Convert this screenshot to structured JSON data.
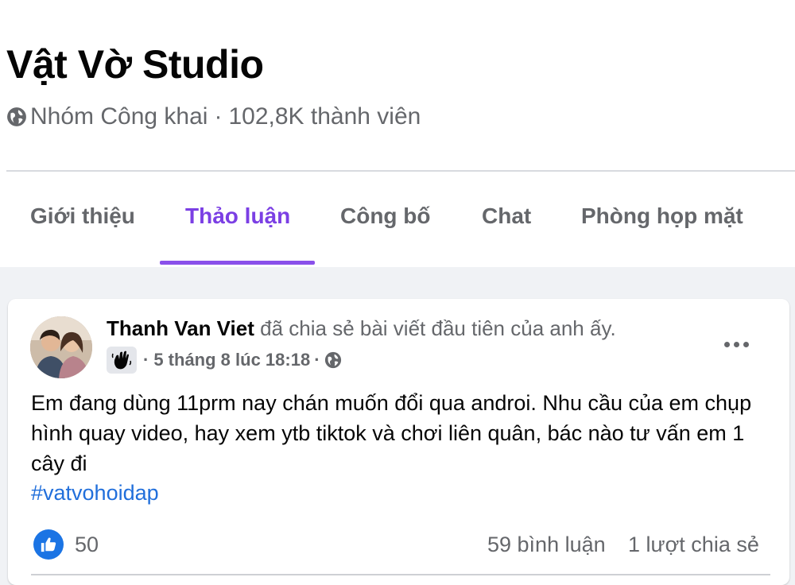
{
  "group": {
    "name": "Vật Vờ Studio",
    "privacy": "Nhóm Công khai",
    "separator": "·",
    "members": "102,8K thành viên"
  },
  "tabs": [
    {
      "label": "Giới thiệu",
      "active": false
    },
    {
      "label": "Thảo luận",
      "active": true
    },
    {
      "label": "Công bố",
      "active": false
    },
    {
      "label": "Chat",
      "active": false
    },
    {
      "label": "Phòng họp mặt",
      "active": false
    }
  ],
  "post": {
    "author": "Thanh Van Viet",
    "action": "đã chia sẻ bài viết đầu tiên của anh ấy.",
    "time_prefix": "·",
    "time": "5 tháng 8 lúc 18:18",
    "time_suffix": "·",
    "body": "Em đang dùng 11prm nay chán muốn đổi qua androi. Nhu cầu của em chụp hình quay video, hay xem ytb tiktok và chơi liên quân, bác nào tư vấn em 1 cây đi",
    "hashtag": "#vatvohoidap",
    "likes": "50",
    "comments": "59 bình luận",
    "shares": "1 lượt chia sẻ"
  },
  "colors": {
    "accent": "#8a50ea",
    "link": "#216fdb",
    "like": "#1b74e4",
    "secondary_text": "#65676b"
  },
  "icons": {
    "privacy": "globe-icon",
    "badge": "waving-hand-icon",
    "audience": "globe-icon",
    "more": "more-options-icon",
    "reaction": "thumbs-up-icon"
  }
}
